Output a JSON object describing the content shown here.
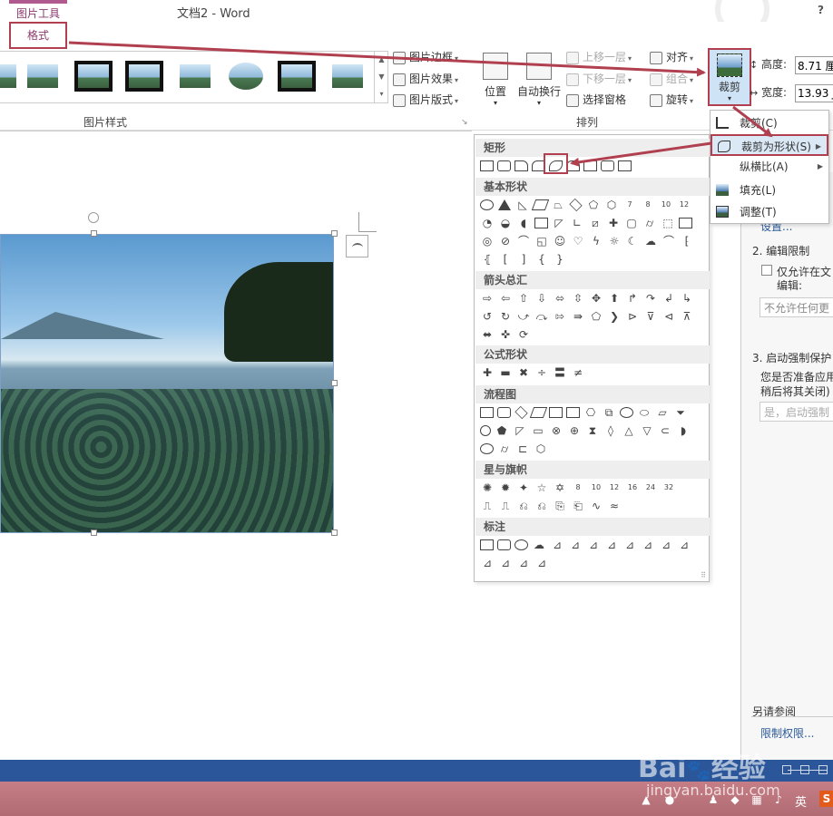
{
  "titlebar": {
    "context_tab": "图片工具",
    "title": "文档2 - Word",
    "help": "?"
  },
  "ribbon": {
    "format_tab": "格式",
    "picture_styles_label": "图片样式",
    "arrange_label": "排列",
    "picture_border": "图片边框",
    "picture_effects": "图片效果",
    "picture_layout": "图片版式",
    "position": "位置",
    "wrap_text": "自动换行",
    "bring_forward": "上移一层",
    "send_backward": "下移一层",
    "selection_pane": "选择窗格",
    "align": "对齐",
    "group": "组合",
    "rotate": "旋转",
    "crop": "裁剪",
    "height_label": "高度:",
    "height_value": "8.71 厘",
    "width_label": "宽度:",
    "width_value": "13.93 J"
  },
  "crop_menu": {
    "crop": "裁剪(C)",
    "crop_to_shape": "裁剪为形状(S)",
    "aspect_ratio": "纵横比(A)",
    "fill": "填充(L)",
    "fit": "调整(T)"
  },
  "shape_panel": {
    "rectangles": "矩形",
    "basic_shapes": "基本形状",
    "block_arrows": "箭头总汇",
    "equation_shapes": "公式形状",
    "flowchart": "流程图",
    "stars_banners": "星与旗帜",
    "callouts": "标注",
    "basic_nums": [
      "7",
      "8",
      "10",
      "12"
    ],
    "star_nums": [
      "8",
      "10",
      "12",
      "16",
      "24",
      "32"
    ],
    "braces": [
      "{",
      "}"
    ]
  },
  "right_pane": {
    "settings_link": "设置...",
    "section2": "2. 编辑限制",
    "only_allow": "仅允许在文",
    "edit_label": "编辑:",
    "no_changes": "不允许任何更",
    "section3": "3. 启动强制保护",
    "ready_q": "您是否准备应用",
    "close_later": "稍后将其关闭)",
    "start_button": "是，启动强制",
    "see_also": "另请参阅",
    "restrict_link": "限制权限..."
  },
  "taskbar": {
    "lang": "英",
    "s_icon": "S"
  },
  "watermark": {
    "logo": "Bai",
    "logo2": "经验",
    "url": "jingyan.baidu.com"
  },
  "colors": {
    "accent_red": "#b04050",
    "status_blue": "#2b579a",
    "context_purple": "#8b3a6e"
  }
}
